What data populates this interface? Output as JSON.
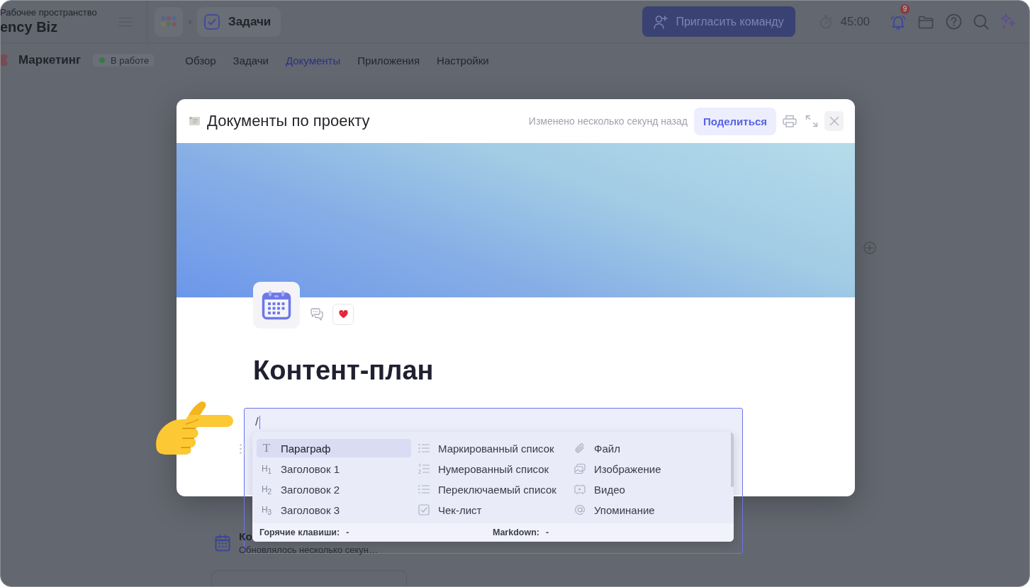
{
  "workspace": {
    "caption": "Рабочее пространство",
    "name": "ency Biz"
  },
  "breadcrumb": {
    "label": "Задачи"
  },
  "invite_button": {
    "label": "Пригласить команду"
  },
  "timer": {
    "time": "45:00"
  },
  "notifications": {
    "badge": "9"
  },
  "project": {
    "name": "Маркетинг",
    "status": "В работе"
  },
  "tabs": [
    {
      "label": "Обзор",
      "selected": false
    },
    {
      "label": "Задачи",
      "selected": false
    },
    {
      "label": "Документы",
      "selected": true
    },
    {
      "label": "Приложения",
      "selected": false
    },
    {
      "label": "Настройки",
      "selected": false
    }
  ],
  "background_card": {
    "title": "Ко",
    "subtitle": "Обновлялось несколько секун…"
  },
  "modal": {
    "title": "Документы по проекту",
    "modified": "Изменено несколько секунд назад",
    "share_button": "Поделиться"
  },
  "document": {
    "title": "Контент-план"
  },
  "editor_block": {
    "value": "/"
  },
  "slash_menu": {
    "columns": [
      {
        "items": [
          {
            "kind": "paragraph",
            "glyph": "T",
            "label": "Параграф",
            "selected": true
          },
          {
            "kind": "heading",
            "glyph": "H$_{1}$",
            "label": "Заголовок 1",
            "selected": false
          },
          {
            "kind": "heading",
            "glyph": "H$_{2}$",
            "label": "Заголовок 2",
            "selected": false
          },
          {
            "kind": "heading",
            "glyph": "H$_{3}$",
            "label": "Заголовок 3",
            "selected": false
          }
        ]
      },
      {
        "items": [
          {
            "kind": "bullets",
            "label": "Маркированный список",
            "selected": false
          },
          {
            "kind": "numbers",
            "label": "Нумерованный список",
            "selected": false
          },
          {
            "kind": "toggles",
            "label": "Переключаемый список",
            "selected": false
          },
          {
            "kind": "checklist",
            "label": "Чек-лист",
            "selected": false
          }
        ]
      },
      {
        "items": [
          {
            "kind": "file",
            "label": "Файл",
            "selected": false
          },
          {
            "kind": "image",
            "label": "Изображение",
            "selected": false
          },
          {
            "kind": "video",
            "label": "Видео",
            "selected": false
          },
          {
            "kind": "mention",
            "label": "Упоминание",
            "selected": false
          }
        ]
      }
    ],
    "footer": [
      {
        "label": "Горячие клавиши:",
        "value": "-"
      },
      {
        "label": "Markdown:",
        "value": "-"
      }
    ]
  }
}
